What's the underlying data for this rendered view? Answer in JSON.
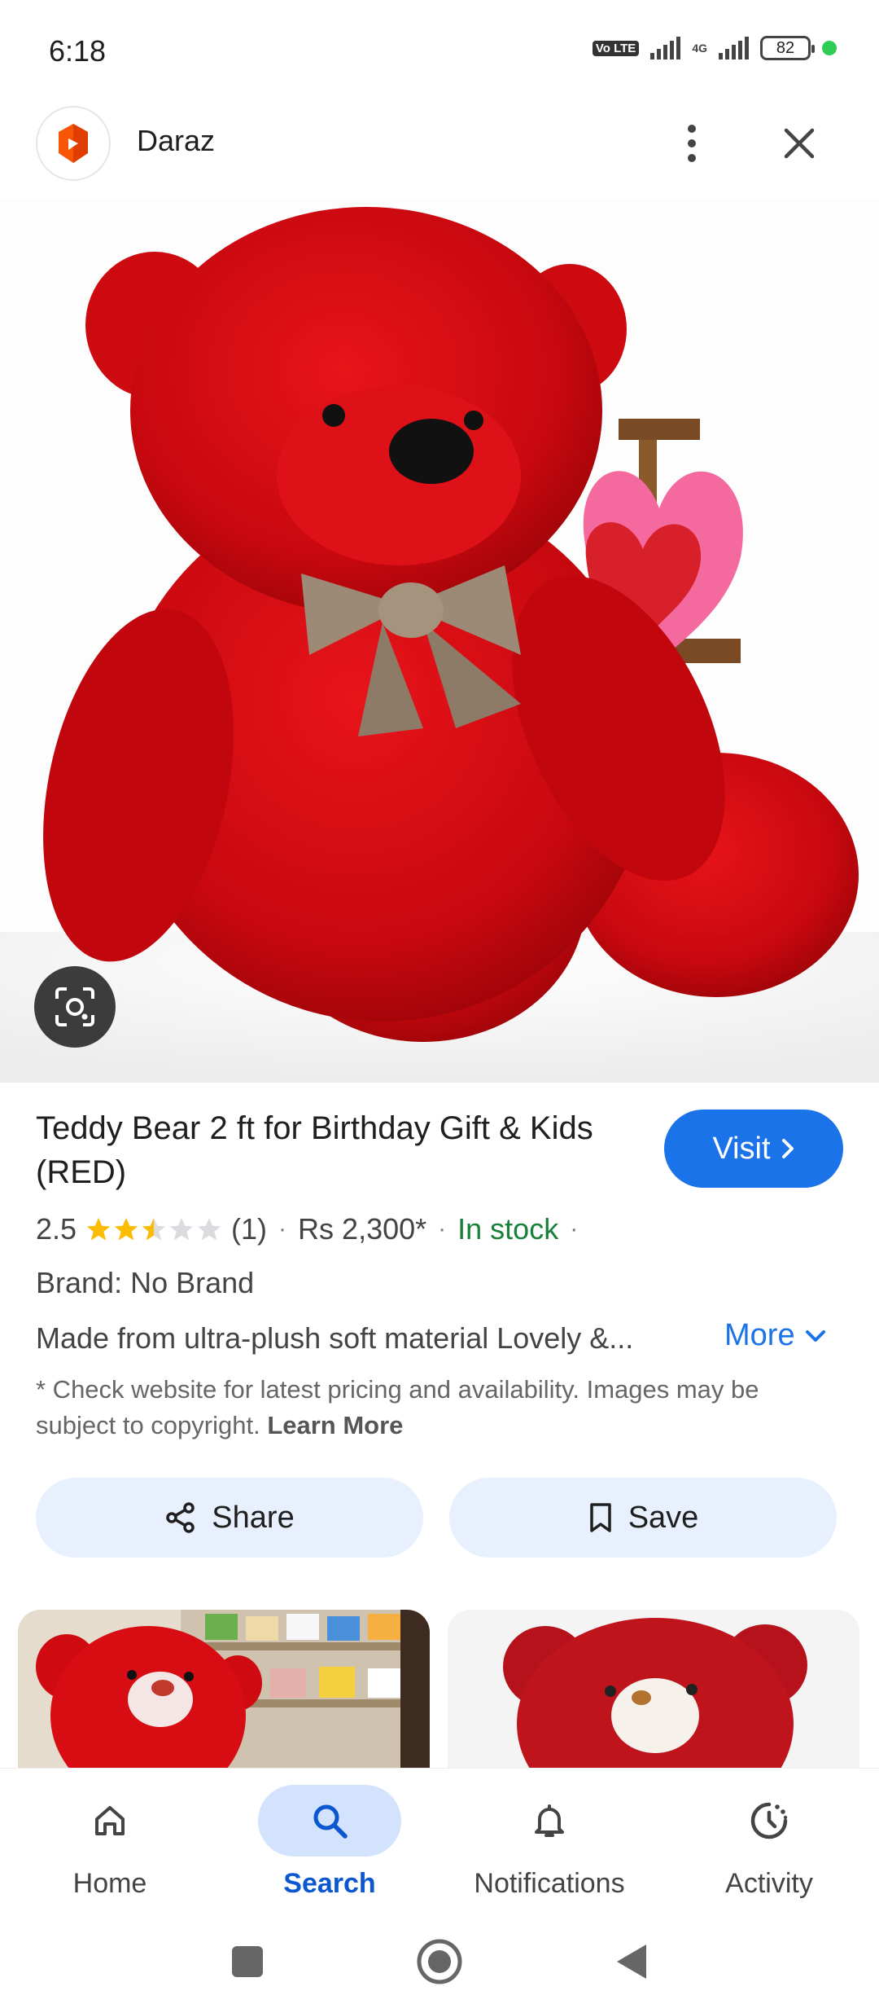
{
  "status_bar": {
    "time": "6:18",
    "volte_label": "Vo LTE",
    "network_label": "4G",
    "battery_level": "82"
  },
  "header": {
    "site_name": "Daraz",
    "more_icon": "more-vert-icon",
    "close_icon": "close-icon"
  },
  "product": {
    "title": "Teddy Bear 2 ft for Birthday Gift & Kids (RED)",
    "visit_label": "Visit",
    "rating_value": "2.5",
    "rating_fraction": 0.5,
    "review_count": "(1)",
    "price": "Rs 2,300*",
    "stock_status": "In stock",
    "brand": "Brand: No Brand",
    "description": "Made from ultra-plush soft material Lovely &...",
    "more_label": "More",
    "disclaimer": "* Check website for latest pricing and availability. Images may be subject to copyright.",
    "learn_more_label": "Learn More"
  },
  "actions": {
    "share_label": "Share",
    "save_label": "Save"
  },
  "bottom_nav": {
    "items": [
      {
        "label": "Home",
        "icon": "home-icon"
      },
      {
        "label": "Search",
        "icon": "search-icon"
      },
      {
        "label": "Notifications",
        "icon": "bell-icon"
      },
      {
        "label": "Activity",
        "icon": "activity-icon"
      }
    ],
    "active_index": 1
  },
  "colors": {
    "accent": "#1a73e8",
    "in_stock": "#188038",
    "star": "#fbbc04",
    "action_bg": "#e8f0fd"
  }
}
